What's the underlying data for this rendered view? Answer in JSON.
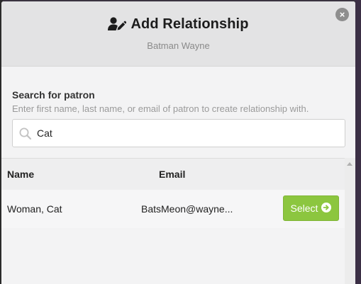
{
  "modal": {
    "title": "Add Relationship",
    "subtitle": "Batman Wayne",
    "close_label": "×"
  },
  "search": {
    "label": "Search for patron",
    "hint": "Enter first name, last name, or email of patron to create relationship with.",
    "value": "Cat"
  },
  "table": {
    "columns": [
      "Name",
      "Email"
    ],
    "rows": [
      {
        "name": "Woman, Cat",
        "email": "BatsMeon@wayne..."
      }
    ],
    "select_label": "Select"
  },
  "colors": {
    "select_green": "#8cc63f",
    "header_bg": "#e3e3e4"
  },
  "icons": {
    "title": "user-edit-icon",
    "search": "search-icon",
    "close": "close-icon",
    "select": "arrow-right-circle-icon"
  }
}
